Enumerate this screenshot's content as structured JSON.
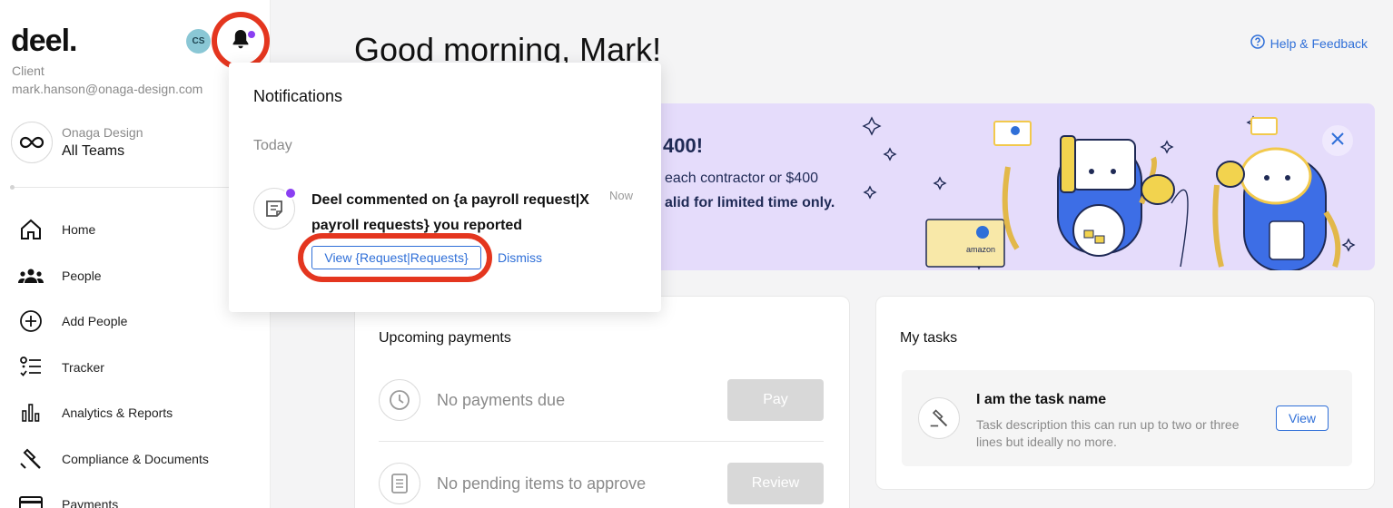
{
  "sidebar": {
    "logo": "deel.",
    "role": "Client",
    "email": "mark.hanson@onaga-design.com",
    "avatar_initials": "CS",
    "team": {
      "org": "Onaga Design",
      "name": "All Teams"
    },
    "items": [
      {
        "label": "Home",
        "icon": "home-icon"
      },
      {
        "label": "People",
        "icon": "people-icon"
      },
      {
        "label": "Add People",
        "icon": "add-circle-icon"
      },
      {
        "label": "Tracker",
        "icon": "tracker-list-icon"
      },
      {
        "label": "Analytics & Reports",
        "icon": "bar-chart-icon"
      },
      {
        "label": "Compliance & Documents",
        "icon": "gavel-icon"
      },
      {
        "label": "Payments",
        "icon": "credit-card-icon"
      }
    ]
  },
  "header": {
    "greeting": "Good morning, Mark!",
    "help_label": "Help & Feedback"
  },
  "banner": {
    "title": "400!",
    "line1": "each contractor or $400",
    "line2": "alid for limited time only.",
    "gift_card_label": "amazon"
  },
  "payments": {
    "title": "Upcoming payments",
    "rows": [
      {
        "text": "No payments due",
        "button": "Pay",
        "icon": "clock-icon"
      },
      {
        "text": "No pending items to approve",
        "button": "Review",
        "icon": "receipt-icon"
      }
    ]
  },
  "tasks": {
    "title": "My tasks",
    "task_name": "I am the task name",
    "task_description": "Task description this can run up to two or three lines but ideally no more.",
    "view_label": "View"
  },
  "notifications": {
    "title": "Notifications",
    "section": "Today",
    "item": {
      "text": "Deel commented on {a payroll request|X payroll requests} you reported",
      "time": "Now",
      "view_label": "View {Request|Requests}",
      "dismiss_label": "Dismiss"
    }
  },
  "colors": {
    "accent": "#2f6fd8",
    "highlight_ring": "#e4361f",
    "unread_dot": "#8a3ff2",
    "banner_bg": "#e5dcfb"
  }
}
